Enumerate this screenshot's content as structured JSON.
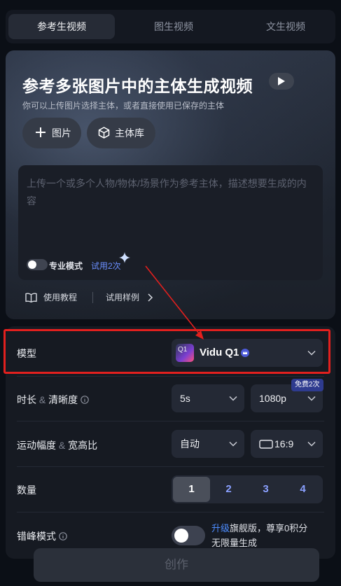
{
  "tabs": [
    {
      "label": "参考生视频",
      "active": true
    },
    {
      "label": "图生视频",
      "active": false
    },
    {
      "label": "文生视频",
      "active": false
    }
  ],
  "hero": {
    "title": "参考多张图片中的主体生成视频",
    "subtitle": "你可以上传图片选择主体，或者直接使用已保存的主体",
    "add_image_label": "图片",
    "subject_library_label": "主体库",
    "prompt_placeholder": "上传一个或多个人物/物体/场景作为参考主体，描述想要生成的内容",
    "pro_mode_label": "专业模式",
    "pro_mode_enabled": false,
    "trial_label": "试用2次",
    "tutorial_label": "使用教程",
    "examples_label": "试用样例"
  },
  "settings": {
    "model_label": "模型",
    "model_badge": "Q1",
    "model_value": "Vidu Q1",
    "duration_label": "时长",
    "amp": "&",
    "resolution_label": "清晰度",
    "duration_value": "5s",
    "resolution_value": "1080p",
    "free_badge": "免费2次",
    "motion_label": "运动幅度",
    "aspect_label": "宽高比",
    "motion_value": "自动",
    "aspect_value": "16:9",
    "quantity_label": "数量",
    "quantity_options": [
      "1",
      "2",
      "3",
      "4"
    ],
    "quantity_selected": "1",
    "offpeak_label": "错峰模式",
    "offpeak_enabled": false,
    "upgrade_link": "升级",
    "upgrade_text": "旗舰版，尊享0积分",
    "upgrade_text2": "无限量生成"
  },
  "create_button": "创作",
  "colors": {
    "highlight": "#e2201e",
    "accent": "#6b8fff",
    "link": "#4e8dff"
  }
}
